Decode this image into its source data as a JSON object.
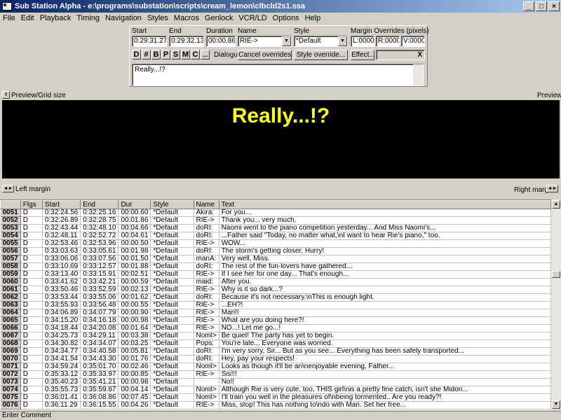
{
  "window": {
    "title": "Sub Station Alpha - e:\\programs\\substation\\scripts\\cream_lemon\\clbcld2s1.ssa"
  },
  "menu": [
    "File",
    "Edit",
    "Playback",
    "Timing",
    "Navigation",
    "Styles",
    "Macros",
    "Genlock",
    "VCR/LD",
    "Options",
    "Help"
  ],
  "editor": {
    "start_label": "Start",
    "start_value": "0:29:31.27",
    "end_label": "End",
    "end_value": "0:29:32.13",
    "duration_label": "Duration",
    "duration_value": "00:00.86",
    "name_label": "Name",
    "name_value": "RIE->",
    "style_label": "Style",
    "style_value": "*Default",
    "margin_label": "Margin Overrides (pixels)",
    "margin_l": "L:0000",
    "margin_r": "R:0000",
    "margin_v": "V:0000",
    "override_buttons": [
      "D",
      "#",
      "B",
      "P",
      "S",
      "M",
      "C",
      "..."
    ],
    "type_label": "Dialogue",
    "cancel_overrides": "Cancel overrides",
    "style_override": "Style override...",
    "effect": "Effect...",
    "close_x": "X",
    "text": "Really...!?"
  },
  "preview": {
    "grid_label": "Preview/Grid size",
    "right_label": "Preview",
    "subtitle": "Really...!?",
    "left_margin_label": "Left margin",
    "right_margin_label": "Right margin"
  },
  "grid": {
    "columns": [
      "",
      "Flgs",
      "Start",
      "End",
      "Dur",
      "Style",
      "Name",
      "Text"
    ],
    "rows": [
      [
        "0051",
        "D",
        "0:32:24.56",
        "0:32:25.16",
        "00:00.60",
        "*Default",
        "Akira:",
        "For you..."
      ],
      [
        "0052",
        "D",
        "0:32:26.89",
        "0:32:28.75",
        "00:01.86",
        "*Default",
        "RIE->",
        "Thank you... very much."
      ],
      [
        "0053",
        "D",
        "0:32:43.44",
        "0:32:48.10",
        "00:04.66",
        "*Default",
        "doRI:",
        "Naomi went to the piano competition yesterday...  And Miss Naomi's..."
      ],
      [
        "0054",
        "D",
        "0:32:48.11",
        "0:32:52.72",
        "00:04.61",
        "*Default",
        "doRI:",
        "...Father said \"Today, no matter what,\\nI want to hear Rie's piano,\" too."
      ],
      [
        "0055",
        "D",
        "0:32:53.46",
        "0:32:53.96",
        "00:00.50",
        "*Default",
        "RIE->",
        "WOW..."
      ],
      [
        "0056",
        "D",
        "0:33:03.63",
        "0:33:05.61",
        "00:01.98",
        "*Default",
        "doRI:",
        "The storm's getting closer. Hurry!"
      ],
      [
        "0057",
        "D",
        "0:33:06.06",
        "0:33:07.56",
        "00:01.50",
        "*Default",
        "manA:",
        "Very well, Miss."
      ],
      [
        "0058",
        "D",
        "0:33:10.69",
        "0:33:12.57",
        "00:01.88",
        "*Default",
        "doRI:",
        "The rest of the fun-lovers have gathered..."
      ],
      [
        "0059",
        "D",
        "0:33:13.40",
        "0:33:15.91",
        "00:02.51",
        "*Default",
        "RIE->",
        "If I see her for one day... That's enough..."
      ],
      [
        "0060",
        "D",
        "0:33:41.62",
        "0:33:42.21",
        "00:00.59",
        "*Default",
        "maid:",
        "After you."
      ],
      [
        "0061",
        "D",
        "0:33:50.46",
        "0:33:52.59",
        "00:02.13",
        "*Default",
        "RIE->",
        "Why is it so dark...?"
      ],
      [
        "0062",
        "D",
        "0:33:53.44",
        "0:33:55.06",
        "00:01.62",
        "*Default",
        "doRI:",
        "Because it's not necessary.\\nThis is enough light."
      ],
      [
        "0063",
        "D",
        "0:33:55.93",
        "0:33:56.48",
        "00:00.55",
        "*Default",
        "RIE->",
        "...EH?!"
      ],
      [
        "0064",
        "D",
        "0:34:06.89",
        "0:34:07.79",
        "00:00.90",
        "*Default",
        "RIE->",
        "Mari!!"
      ],
      [
        "0065",
        "D",
        "0:34:15.20",
        "0:34:16.18",
        "00:00.98",
        "*Default",
        "RIE->",
        "What are you doing here?!"
      ],
      [
        "0066",
        "D",
        "0:34:18.44",
        "0:34:20.08",
        "00:01.64",
        "*Default",
        "RIE->",
        "NO...! Let me go...!"
      ],
      [
        "0067",
        "D",
        "0:34:25.73",
        "0:34:29.11",
        "00:03.38",
        "*Default",
        "Noml>",
        "Be quiet! The party has yet to begin."
      ],
      [
        "0068",
        "D",
        "0:34:30.82",
        "0:34:34.07",
        "00:03.25",
        "*Default",
        "Pops:",
        "You're late... Everyone was worried."
      ],
      [
        "0069",
        "D",
        "0:34:34.77",
        "0:34:40.58",
        "00:05.81",
        "*Default",
        "doRI:",
        "I'm very sorry, Sir... But as you see... Everything has been safely transported..."
      ],
      [
        "0070",
        "D",
        "0:34:41.54",
        "0:34:43.30",
        "00:01.76",
        "*Default",
        "doRI:",
        "Hey, pay your respects!"
      ],
      [
        "0071",
        "D",
        "0:34:59.24",
        "0:35:01.70",
        "00:02.46",
        "*Default",
        "Noml>",
        "Looks as though it'll be an\\nenjoyable evening, Father..."
      ],
      [
        "0072",
        "D",
        "0:35:33.12",
        "0:35:33.97",
        "00:00.85",
        "*Default",
        "RIE->",
        "Sis!!!"
      ],
      [
        "0073",
        "D",
        "0:35:40.23",
        "0:35:41.21",
        "00:00.98",
        "*Default",
        "",
        "No!!"
      ],
      [
        "0074",
        "D",
        "0:35:55.73",
        "0:35:59.87",
        "00:04.14",
        "*Default",
        "Noml>",
        "Although Rie is very cute, too, THIS girl\\nis a pretty fine catch, isn't she Midori..."
      ],
      [
        "0075",
        "D",
        "0:36:01.41",
        "0:36:08.86",
        "00:07.45",
        "*Default",
        "Noml>",
        "I'll train you well in the pleasures of\\nbeing tormented.. Are you ready?!"
      ],
      [
        "0076",
        "D",
        "0:36:11.29",
        "0:36:15.55",
        "00:04.26",
        "*Default",
        "RIE->",
        "Miss, stop! This has nothing to\\ndo with Mari. Set her free..."
      ]
    ]
  },
  "status": {
    "text": "Enter Comment"
  },
  "colors": {
    "title_bar": "#0a246a",
    "preview_bg": "#000000",
    "subtitle": "#ffff00",
    "face": "#d4d0c8"
  }
}
